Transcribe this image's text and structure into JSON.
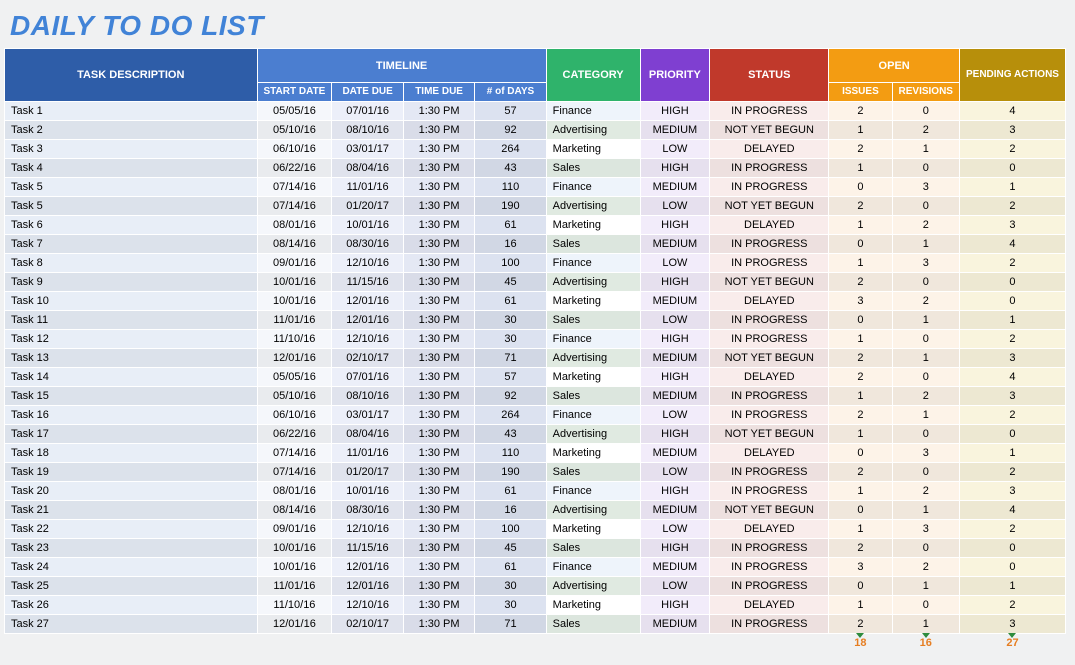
{
  "title": "DAILY TO DO LIST",
  "headers": {
    "desc": "TASK DESCRIPTION",
    "timeline": "TIMELINE",
    "category": "CATEGORY",
    "priority": "PRIORITY",
    "status": "STATUS",
    "open": "OPEN",
    "pending": "PENDING ACTIONS",
    "start": "START DATE",
    "due": "DATE DUE",
    "time": "TIME DUE",
    "days": "# of DAYS",
    "issues": "ISSUES",
    "revisions": "REVISIONS"
  },
  "rows": [
    {
      "desc": "Task 1",
      "start": "05/05/16",
      "due": "07/01/16",
      "time": "1:30 PM",
      "days": "57",
      "cat": "Finance",
      "pri": "HIGH",
      "stat": "IN PROGRESS",
      "iss": "2",
      "rev": "0",
      "pend": "4"
    },
    {
      "desc": "Task 2",
      "start": "05/10/16",
      "due": "08/10/16",
      "time": "1:30 PM",
      "days": "92",
      "cat": "Advertising",
      "pri": "MEDIUM",
      "stat": "NOT YET BEGUN",
      "iss": "1",
      "rev": "2",
      "pend": "3"
    },
    {
      "desc": "Task 3",
      "start": "06/10/16",
      "due": "03/01/17",
      "time": "1:30 PM",
      "days": "264",
      "cat": "Marketing",
      "pri": "LOW",
      "stat": "DELAYED",
      "iss": "2",
      "rev": "1",
      "pend": "2"
    },
    {
      "desc": "Task 4",
      "start": "06/22/16",
      "due": "08/04/16",
      "time": "1:30 PM",
      "days": "43",
      "cat": "Sales",
      "pri": "HIGH",
      "stat": "IN PROGRESS",
      "iss": "1",
      "rev": "0",
      "pend": "0"
    },
    {
      "desc": "Task 5",
      "start": "07/14/16",
      "due": "11/01/16",
      "time": "1:30 PM",
      "days": "110",
      "cat": "Finance",
      "pri": "MEDIUM",
      "stat": "IN PROGRESS",
      "iss": "0",
      "rev": "3",
      "pend": "1"
    },
    {
      "desc": "Task 5",
      "start": "07/14/16",
      "due": "01/20/17",
      "time": "1:30 PM",
      "days": "190",
      "cat": "Advertising",
      "pri": "LOW",
      "stat": "NOT YET BEGUN",
      "iss": "2",
      "rev": "0",
      "pend": "2"
    },
    {
      "desc": "Task 6",
      "start": "08/01/16",
      "due": "10/01/16",
      "time": "1:30 PM",
      "days": "61",
      "cat": "Marketing",
      "pri": "HIGH",
      "stat": "DELAYED",
      "iss": "1",
      "rev": "2",
      "pend": "3"
    },
    {
      "desc": "Task 7",
      "start": "08/14/16",
      "due": "08/30/16",
      "time": "1:30 PM",
      "days": "16",
      "cat": "Sales",
      "pri": "MEDIUM",
      "stat": "IN PROGRESS",
      "iss": "0",
      "rev": "1",
      "pend": "4"
    },
    {
      "desc": "Task 8",
      "start": "09/01/16",
      "due": "12/10/16",
      "time": "1:30 PM",
      "days": "100",
      "cat": "Finance",
      "pri": "LOW",
      "stat": "IN PROGRESS",
      "iss": "1",
      "rev": "3",
      "pend": "2"
    },
    {
      "desc": "Task 9",
      "start": "10/01/16",
      "due": "11/15/16",
      "time": "1:30 PM",
      "days": "45",
      "cat": "Advertising",
      "pri": "HIGH",
      "stat": "NOT YET BEGUN",
      "iss": "2",
      "rev": "0",
      "pend": "0"
    },
    {
      "desc": "Task 10",
      "start": "10/01/16",
      "due": "12/01/16",
      "time": "1:30 PM",
      "days": "61",
      "cat": "Marketing",
      "pri": "MEDIUM",
      "stat": "DELAYED",
      "iss": "3",
      "rev": "2",
      "pend": "0"
    },
    {
      "desc": "Task 11",
      "start": "11/01/16",
      "due": "12/01/16",
      "time": "1:30 PM",
      "days": "30",
      "cat": "Sales",
      "pri": "LOW",
      "stat": "IN PROGRESS",
      "iss": "0",
      "rev": "1",
      "pend": "1"
    },
    {
      "desc": "Task 12",
      "start": "11/10/16",
      "due": "12/10/16",
      "time": "1:30 PM",
      "days": "30",
      "cat": "Finance",
      "pri": "HIGH",
      "stat": "IN PROGRESS",
      "iss": "1",
      "rev": "0",
      "pend": "2"
    },
    {
      "desc": "Task 13",
      "start": "12/01/16",
      "due": "02/10/17",
      "time": "1:30 PM",
      "days": "71",
      "cat": "Advertising",
      "pri": "MEDIUM",
      "stat": "NOT YET BEGUN",
      "iss": "2",
      "rev": "1",
      "pend": "3"
    },
    {
      "desc": "Task 14",
      "start": "05/05/16",
      "due": "07/01/16",
      "time": "1:30 PM",
      "days": "57",
      "cat": "Marketing",
      "pri": "HIGH",
      "stat": "DELAYED",
      "iss": "2",
      "rev": "0",
      "pend": "4"
    },
    {
      "desc": "Task 15",
      "start": "05/10/16",
      "due": "08/10/16",
      "time": "1:30 PM",
      "days": "92",
      "cat": "Sales",
      "pri": "MEDIUM",
      "stat": "IN PROGRESS",
      "iss": "1",
      "rev": "2",
      "pend": "3"
    },
    {
      "desc": "Task 16",
      "start": "06/10/16",
      "due": "03/01/17",
      "time": "1:30 PM",
      "days": "264",
      "cat": "Finance",
      "pri": "LOW",
      "stat": "IN PROGRESS",
      "iss": "2",
      "rev": "1",
      "pend": "2"
    },
    {
      "desc": "Task 17",
      "start": "06/22/16",
      "due": "08/04/16",
      "time": "1:30 PM",
      "days": "43",
      "cat": "Advertising",
      "pri": "HIGH",
      "stat": "NOT YET BEGUN",
      "iss": "1",
      "rev": "0",
      "pend": "0"
    },
    {
      "desc": "Task 18",
      "start": "07/14/16",
      "due": "11/01/16",
      "time": "1:30 PM",
      "days": "110",
      "cat": "Marketing",
      "pri": "MEDIUM",
      "stat": "DELAYED",
      "iss": "0",
      "rev": "3",
      "pend": "1"
    },
    {
      "desc": "Task 19",
      "start": "07/14/16",
      "due": "01/20/17",
      "time": "1:30 PM",
      "days": "190",
      "cat": "Sales",
      "pri": "LOW",
      "stat": "IN PROGRESS",
      "iss": "2",
      "rev": "0",
      "pend": "2"
    },
    {
      "desc": "Task 20",
      "start": "08/01/16",
      "due": "10/01/16",
      "time": "1:30 PM",
      "days": "61",
      "cat": "Finance",
      "pri": "HIGH",
      "stat": "IN PROGRESS",
      "iss": "1",
      "rev": "2",
      "pend": "3"
    },
    {
      "desc": "Task 21",
      "start": "08/14/16",
      "due": "08/30/16",
      "time": "1:30 PM",
      "days": "16",
      "cat": "Advertising",
      "pri": "MEDIUM",
      "stat": "NOT YET BEGUN",
      "iss": "0",
      "rev": "1",
      "pend": "4"
    },
    {
      "desc": "Task 22",
      "start": "09/01/16",
      "due": "12/10/16",
      "time": "1:30 PM",
      "days": "100",
      "cat": "Marketing",
      "pri": "LOW",
      "stat": "DELAYED",
      "iss": "1",
      "rev": "3",
      "pend": "2"
    },
    {
      "desc": "Task 23",
      "start": "10/01/16",
      "due": "11/15/16",
      "time": "1:30 PM",
      "days": "45",
      "cat": "Sales",
      "pri": "HIGH",
      "stat": "IN PROGRESS",
      "iss": "2",
      "rev": "0",
      "pend": "0"
    },
    {
      "desc": "Task 24",
      "start": "10/01/16",
      "due": "12/01/16",
      "time": "1:30 PM",
      "days": "61",
      "cat": "Finance",
      "pri": "MEDIUM",
      "stat": "IN PROGRESS",
      "iss": "3",
      "rev": "2",
      "pend": "0"
    },
    {
      "desc": "Task 25",
      "start": "11/01/16",
      "due": "12/01/16",
      "time": "1:30 PM",
      "days": "30",
      "cat": "Advertising",
      "pri": "LOW",
      "stat": "IN PROGRESS",
      "iss": "0",
      "rev": "1",
      "pend": "1"
    },
    {
      "desc": "Task 26",
      "start": "11/10/16",
      "due": "12/10/16",
      "time": "1:30 PM",
      "days": "30",
      "cat": "Marketing",
      "pri": "HIGH",
      "stat": "DELAYED",
      "iss": "1",
      "rev": "0",
      "pend": "2"
    },
    {
      "desc": "Task 27",
      "start": "12/01/16",
      "due": "02/10/17",
      "time": "1:30 PM",
      "days": "71",
      "cat": "Sales",
      "pri": "MEDIUM",
      "stat": "IN PROGRESS",
      "iss": "2",
      "rev": "1",
      "pend": "3"
    }
  ],
  "totals": {
    "issues": "18",
    "revisions": "16",
    "pending": "27"
  },
  "catClass": {
    "Finance": "cat-finance",
    "Advertising": "cat-advertising",
    "Marketing": "cat-marketing",
    "Sales": "cat-sales"
  }
}
